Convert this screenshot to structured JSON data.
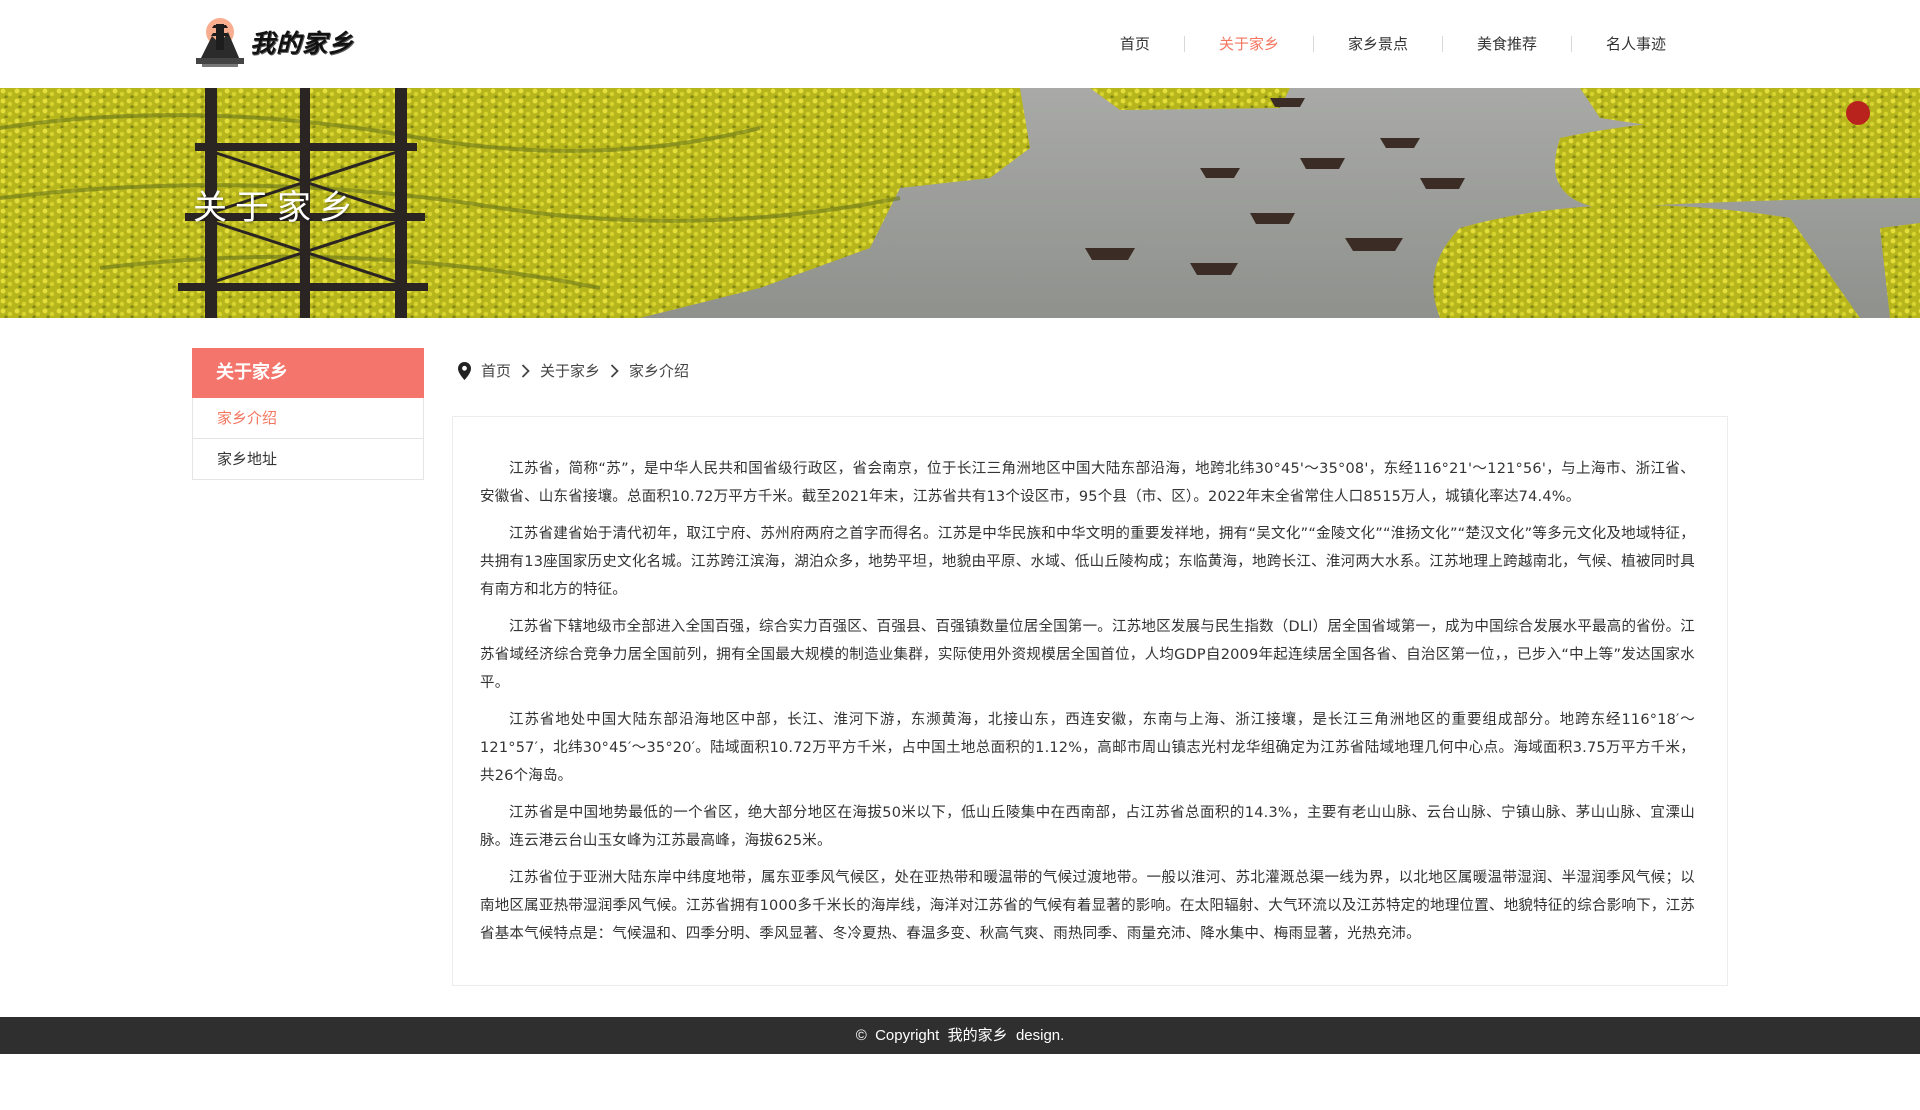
{
  "header": {
    "logo_text": "我的家乡",
    "nav": [
      {
        "label": "首页"
      },
      {
        "label": "关于家乡"
      },
      {
        "label": "家乡景点"
      },
      {
        "label": "美食推荐"
      },
      {
        "label": "名人事迹"
      }
    ],
    "active_nav": "关于家乡"
  },
  "banner": {
    "title": "关于家乡"
  },
  "sidebar": {
    "heading": "关于家乡",
    "items": [
      {
        "label": "家乡介绍"
      },
      {
        "label": "家乡地址"
      }
    ],
    "active_item": "家乡介绍"
  },
  "breadcrumb": [
    "首页",
    "关于家乡",
    "家乡介绍"
  ],
  "content": {
    "paragraphs": [
      "江苏省，简称“苏”，是中华人民共和国省级行政区，省会南京，位于长江三角洲地区中国大陆东部沿海，地跨北纬30°45'～35°08'，东经116°21'～121°56'，与上海市、浙江省、安徽省、山东省接壤。总面积10.72万平方千米。截至2021年末，江苏省共有13个设区市，95个县（市、区）。2022年末全省常住人口8515万人，城镇化率达74.4%。",
      "江苏省建省始于清代初年，取江宁府、苏州府两府之首字而得名。江苏是中华民族和中华文明的重要发祥地，拥有“吴文化”“金陵文化”“淮扬文化”“楚汉文化”等多元文化及地域特征，共拥有13座国家历史文化名城。江苏跨江滨海，湖泊众多，地势平坦，地貌由平原、水域、低山丘陵构成；东临黄海，地跨长江、淮河两大水系。江苏地理上跨越南北，气候、植被同时具有南方和北方的特征。",
      "江苏省下辖地级市全部进入全国百强，综合实力百强区、百强县、百强镇数量位居全国第一。江苏地区发展与民生指数（DLI）居全国省域第一，成为中国综合发展水平最高的省份。江苏省域经济综合竞争力居全国前列，拥有全国最大规模的制造业集群，实际使用外资规模居全国首位，人均GDP自2009年起连续居全国各省、自治区第一位，，已步入“中上等”发达国家水平。",
      "江苏省地处中国大陆东部沿海地区中部，长江、淮河下游，东濒黄海，北接山东，西连安徽，东南与上海、浙江接壤，是长江三角洲地区的重要组成部分。地跨东经116°18′～121°57′，北纬30°45′～35°20′。陆域面积10.72万平方千米，占中国土地总面积的1.12%，高邮市周山镇志光村龙华组确定为江苏省陆域地理几何中心点。海域面积3.75万平方千米，共26个海岛。",
      "江苏省是中国地势最低的一个省区，绝大部分地区在海拔50米以下，低山丘陵集中在西南部，占江苏省总面积的14.3%，主要有老山山脉、云台山脉、宁镇山脉、茅山山脉、宜溧山脉。连云港云台山玉女峰为江苏最高峰，海拔625米。",
      "江苏省位于亚洲大陆东岸中纬度地带，属东亚季风气候区，处在亚热带和暖温带的气候过渡地带。一般以淮河、苏北灌溉总渠一线为界，以北地区属暖温带湿润、半湿润季风气候；以南地区属亚热带湿润季风气候。江苏省拥有1000多千米长的海岸线，海洋对江苏省的气候有着显著的影响。在太阳辐射、大气环流以及江苏特定的地理位置、地貌特征的综合影响下，江苏省基本气候特点是：气候温和、四季分明、季风显著、冬冷夏热、春温多变、秋高气爽、雨热同季、雨量充沛、降水集中、梅雨显著，光热充沛。"
    ]
  },
  "footer": {
    "copyright": "©  Copyright  我的家乡  design."
  },
  "colors": {
    "accent": "#f4765f",
    "sidebar_head": "#f4756b",
    "footer_bg": "#2f2f2f"
  }
}
